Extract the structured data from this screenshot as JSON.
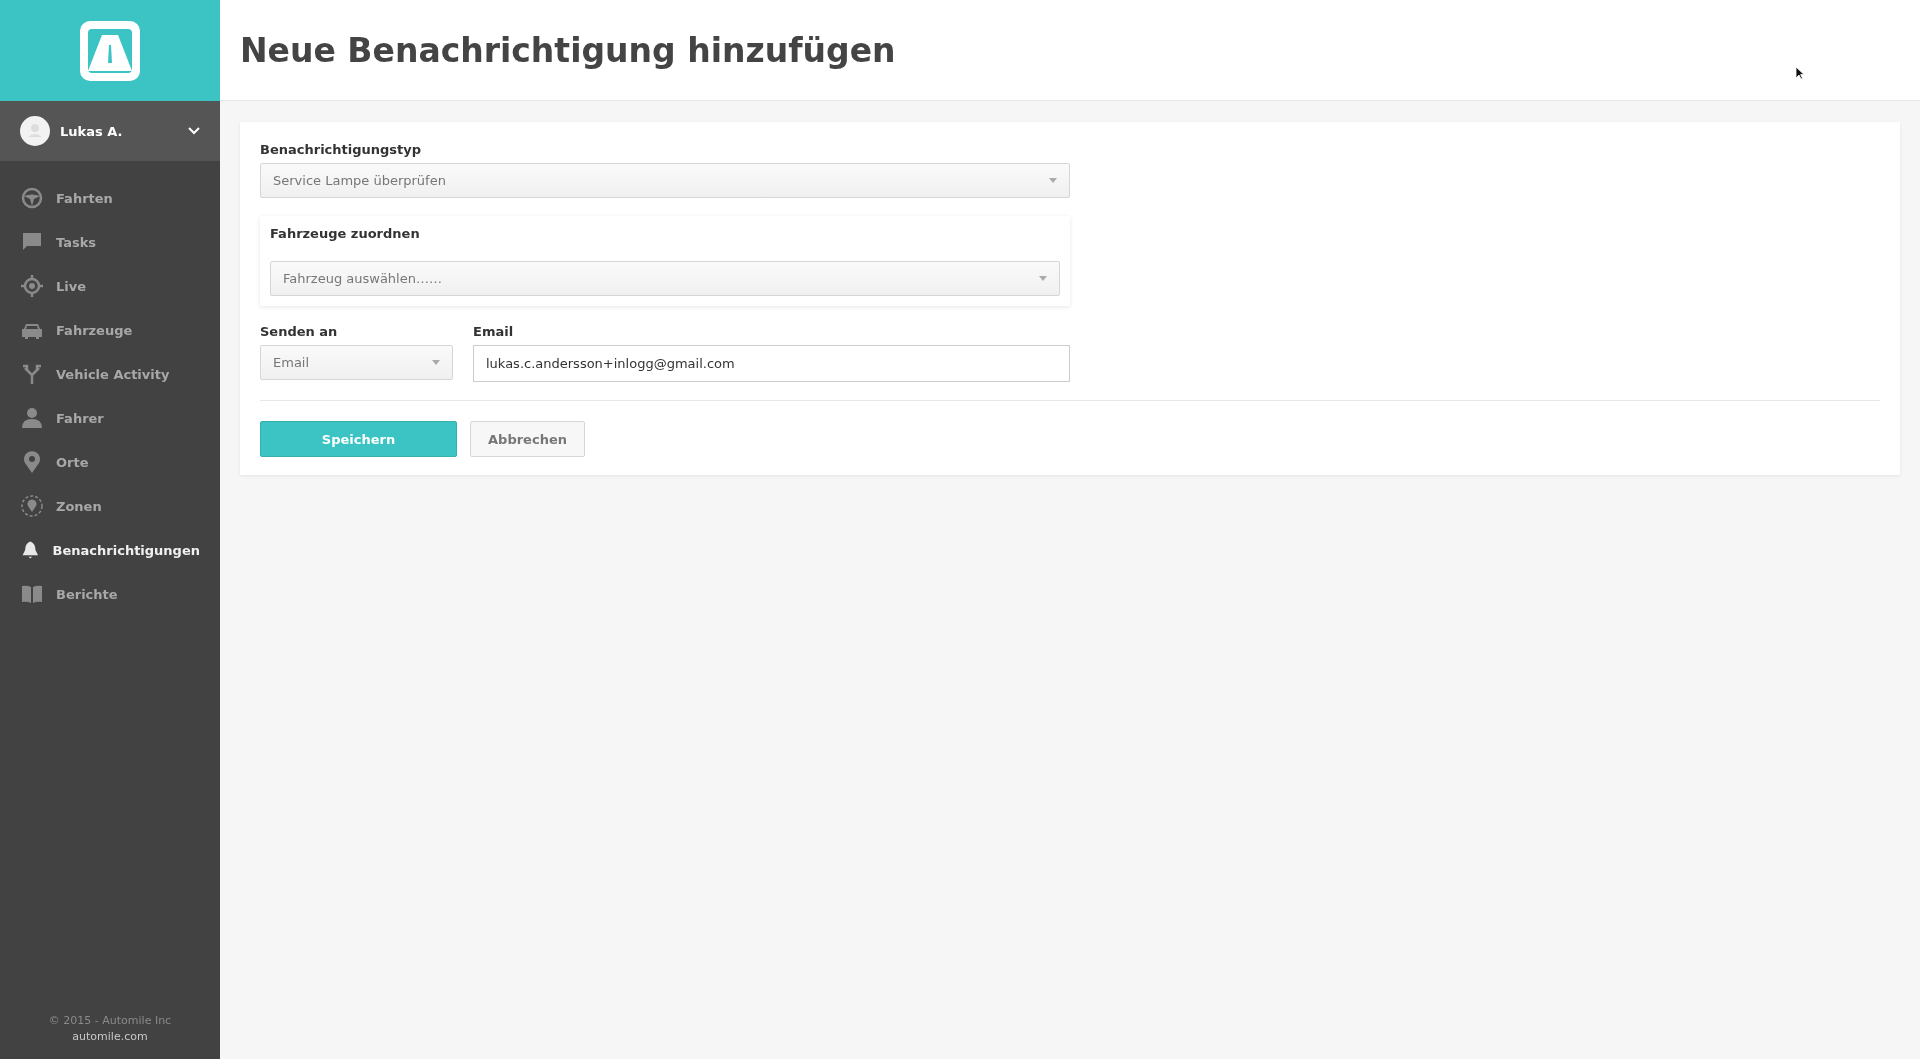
{
  "user": {
    "name": "Lukas A."
  },
  "nav": [
    {
      "label": "Fahrten",
      "selected": false
    },
    {
      "label": "Tasks",
      "selected": false
    },
    {
      "label": "Live",
      "selected": false
    },
    {
      "label": "Fahrzeuge",
      "selected": false
    },
    {
      "label": "Vehicle Activity",
      "selected": false
    },
    {
      "label": "Fahrer",
      "selected": false
    },
    {
      "label": "Orte",
      "selected": false
    },
    {
      "label": "Zonen",
      "selected": false
    },
    {
      "label": "Benachrichtigungen",
      "selected": true
    },
    {
      "label": "Berichte",
      "selected": false
    }
  ],
  "footer": {
    "copyright": "© 2015 - Automile Inc",
    "link": "automile.com"
  },
  "page_title": "Neue Benachrichtigung hinzufügen",
  "form": {
    "type_label": "Benachrichtigungstyp",
    "type_value": "Service Lampe überprüfen",
    "vehicles_label": "Fahrzeuge zuordnen",
    "vehicles_placeholder": "Fahrzeug auswählen……",
    "send_label": "Senden an",
    "send_value": "Email",
    "email_label": "Email",
    "email_value": "lukas.c.andersson+inlogg@gmail.com",
    "save": "Speichern",
    "cancel": "Abbrechen"
  }
}
